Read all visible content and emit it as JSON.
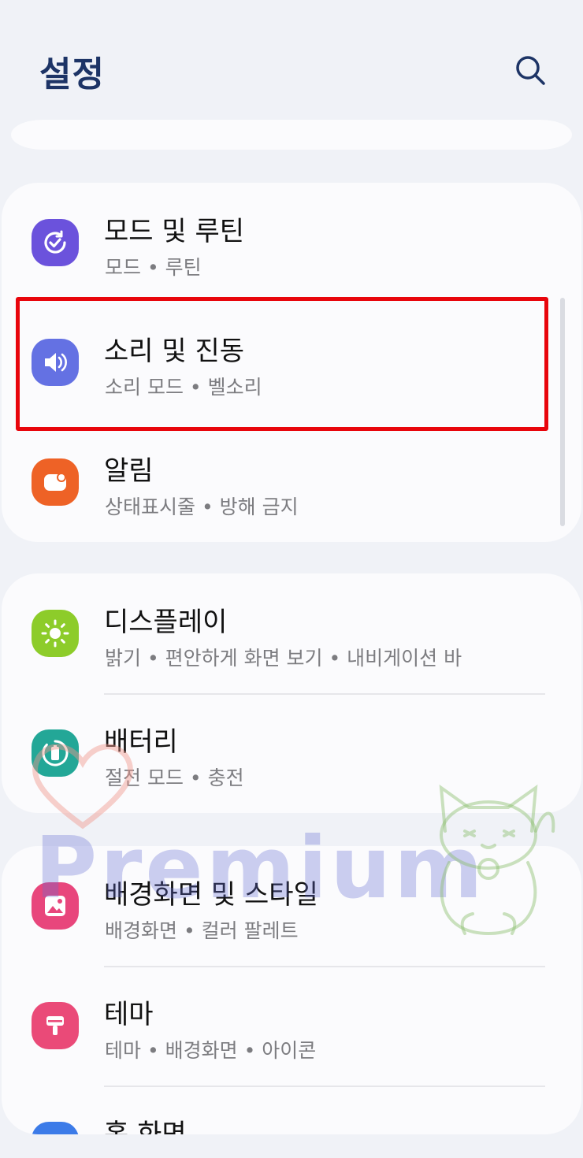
{
  "header": {
    "title": "설정"
  },
  "menu": {
    "group1": [
      {
        "title": "모드 및 루틴",
        "subtitle": "모드 • 루틴",
        "icon": "mode-routine-icon",
        "color": "#6b52dc"
      },
      {
        "title": "소리 및 진동",
        "subtitle": "소리 모드 • 벨소리",
        "icon": "speaker-icon",
        "color": "#6471e3"
      },
      {
        "title": "알림",
        "subtitle": "상태표시줄 • 방해 금지",
        "icon": "notification-icon",
        "color": "#ee6226"
      }
    ],
    "group2": [
      {
        "title": "디스플레이",
        "subtitle": "밝기 • 편안하게 화면 보기 • 내비게이션 바",
        "icon": "brightness-icon",
        "color": "#8dcc2a"
      },
      {
        "title": "배터리",
        "subtitle": "절전 모드 • 충전",
        "icon": "battery-icon",
        "color": "#23a797"
      }
    ],
    "group3": [
      {
        "title": "배경화면 및 스타일",
        "subtitle": "배경화면 • 컬러 팔레트",
        "icon": "wallpaper-icon",
        "color": "#e8467c"
      },
      {
        "title": "테마",
        "subtitle": "테마 • 배경화면 • 아이콘",
        "icon": "theme-icon",
        "color": "#ea4a78"
      },
      {
        "title": "홈 화면",
        "subtitle": "",
        "icon": "home-screen-icon",
        "color": "#3c7be8"
      }
    ]
  },
  "watermark": {
    "text": "Premium"
  },
  "colors": {
    "accent": "#1d3466",
    "highlight": "#e8050c",
    "background": "#f0f2f7",
    "card": "#fbfbfd"
  }
}
